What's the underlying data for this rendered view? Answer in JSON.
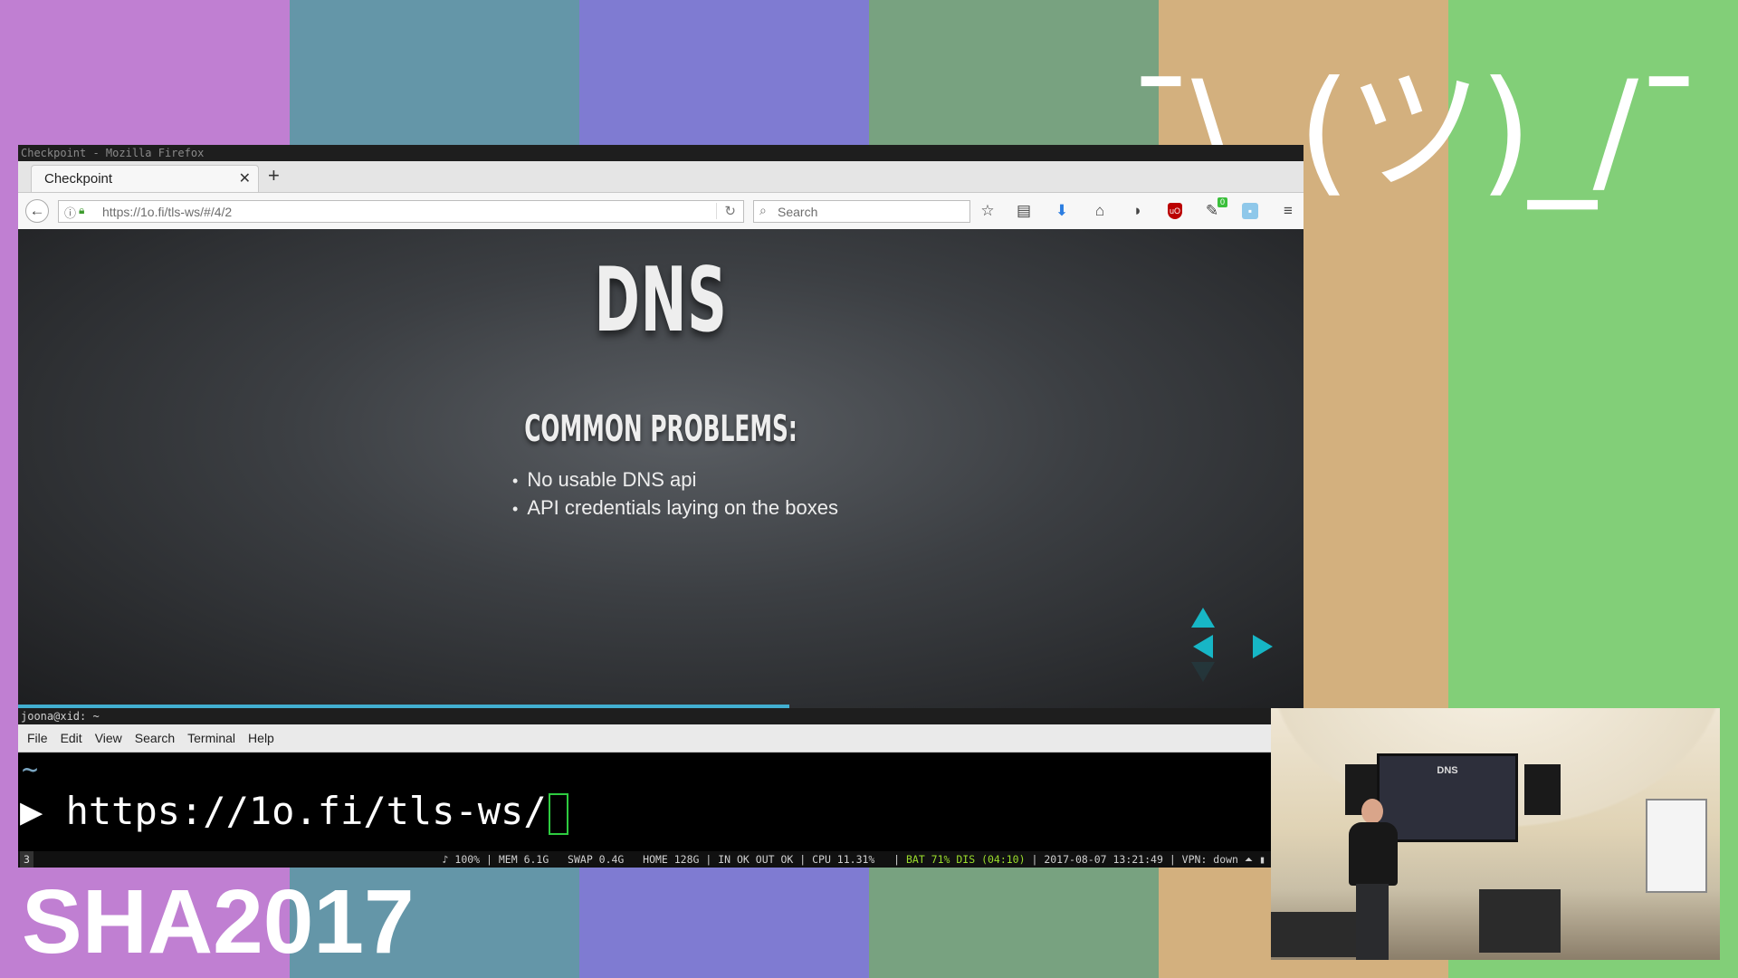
{
  "colors": {
    "stripes": [
      "#c07fd2",
      "#6496a8",
      "#7f7bd2",
      "#78a280",
      "#d3b07e",
      "#82cf78"
    ],
    "accent_arrows": "#13daec",
    "progress": "#42afd1",
    "status_battery": "#9bde2c"
  },
  "overlay": {
    "shrug": "¯\\_(ツ)_/¯",
    "event": "SHA2017"
  },
  "firefox": {
    "window_title": "Checkpoint - Mozilla Firefox",
    "tab_title": "Checkpoint",
    "url": "https://1o.fi/tls-ws/#/4/2",
    "search_placeholder": "Search",
    "toolbar_icons": [
      "bookmark-star-icon",
      "reading-list-icon",
      "download-icon",
      "home-icon",
      "pocket-icon",
      "ublock-icon",
      "extension-icon",
      "screenshot-icon",
      "menu-icon"
    ],
    "extension_badge": "0",
    "progress": 0.6
  },
  "slide": {
    "title": "DNS",
    "subtitle": "COMMON PROBLEMS:",
    "bullets": [
      "No usable DNS api",
      "API credentials laying on the boxes"
    ]
  },
  "terminal": {
    "window_title": "joona@xid: ~",
    "menu": [
      "File",
      "Edit",
      "View",
      "Search",
      "Terminal",
      "Help"
    ],
    "cwd": "~",
    "prompt_symbol": "▶",
    "command": "https://1o.fi/tls-ws/"
  },
  "statusbar": {
    "workspace": "3",
    "volume": "♪ 100%",
    "mem": "MEM 6.1G",
    "swap": "SWAP 0.4G",
    "home": "HOME 128G",
    "net": "IN OK OUT OK",
    "cpu": "CPU 11.31%",
    "battery": "BAT 71% DIS (04:10)",
    "datetime": "2017-08-07 13:21:49",
    "vpn": "VPN: down"
  },
  "webcam": {
    "screen_title": "DNS"
  }
}
